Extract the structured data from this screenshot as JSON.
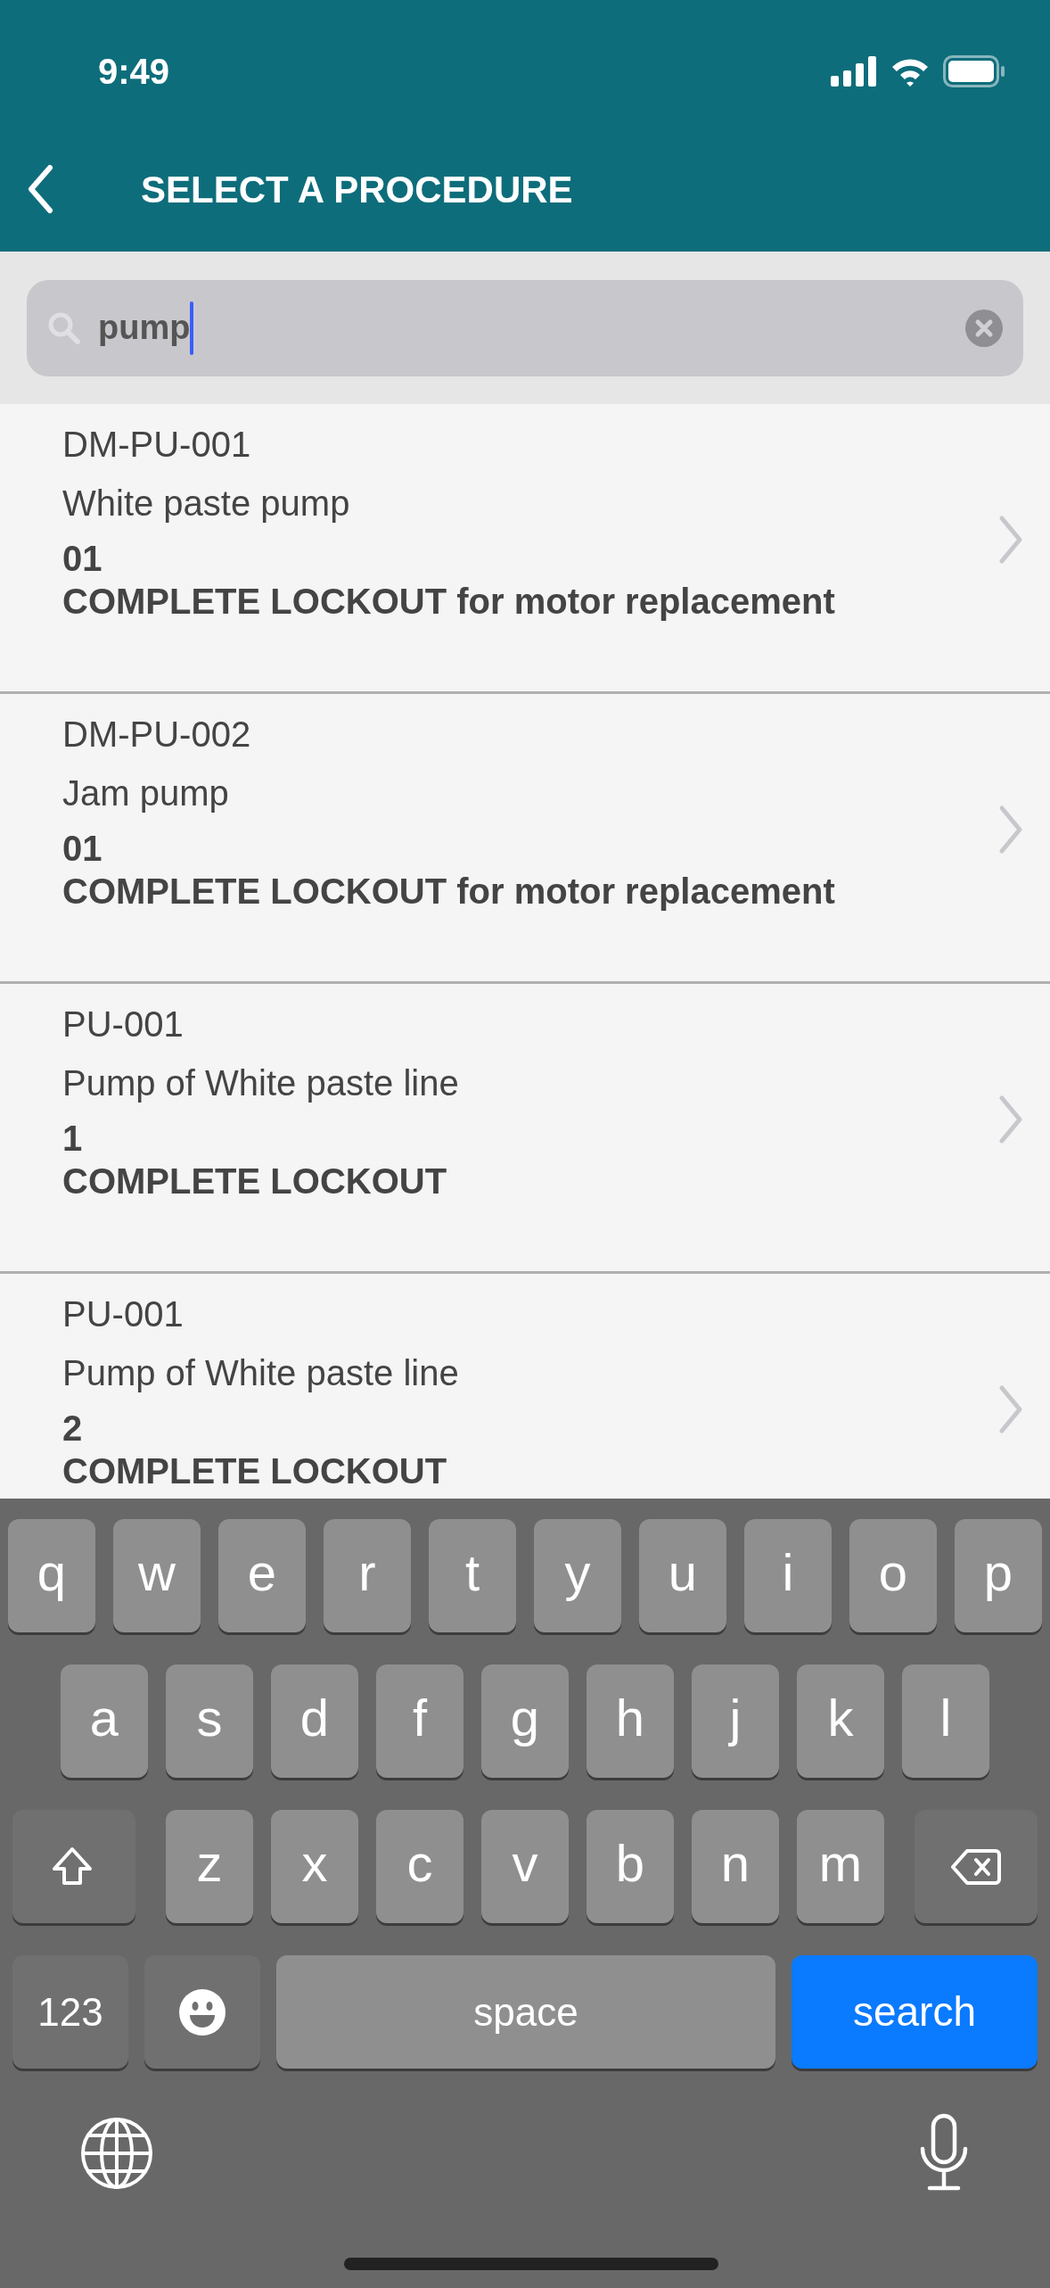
{
  "status_bar": {
    "time": "9:49"
  },
  "header": {
    "title": "SELECT A PROCEDURE"
  },
  "search": {
    "value": "pump"
  },
  "procedures": [
    {
      "code": "DM-PU-001",
      "name": "White paste pump",
      "number": "01",
      "description": "COMPLETE LOCKOUT for motor replacement"
    },
    {
      "code": "DM-PU-002",
      "name": "Jam pump",
      "number": "01",
      "description": "COMPLETE LOCKOUT for motor replacement"
    },
    {
      "code": "PU-001",
      "name": "Pump of White paste line",
      "number": "1",
      "description": "COMPLETE LOCKOUT"
    },
    {
      "code": "PU-001",
      "name": "Pump of White paste line",
      "number": "2",
      "description": "COMPLETE LOCKOUT"
    }
  ],
  "keyboard": {
    "rows": [
      [
        "q",
        "w",
        "e",
        "r",
        "t",
        "y",
        "u",
        "i",
        "o",
        "p"
      ],
      [
        "a",
        "s",
        "d",
        "f",
        "g",
        "h",
        "j",
        "k",
        "l"
      ],
      [
        "z",
        "x",
        "c",
        "v",
        "b",
        "n",
        "m"
      ]
    ],
    "numbers_key": "123",
    "space_key": "space",
    "search_key": "search"
  }
}
